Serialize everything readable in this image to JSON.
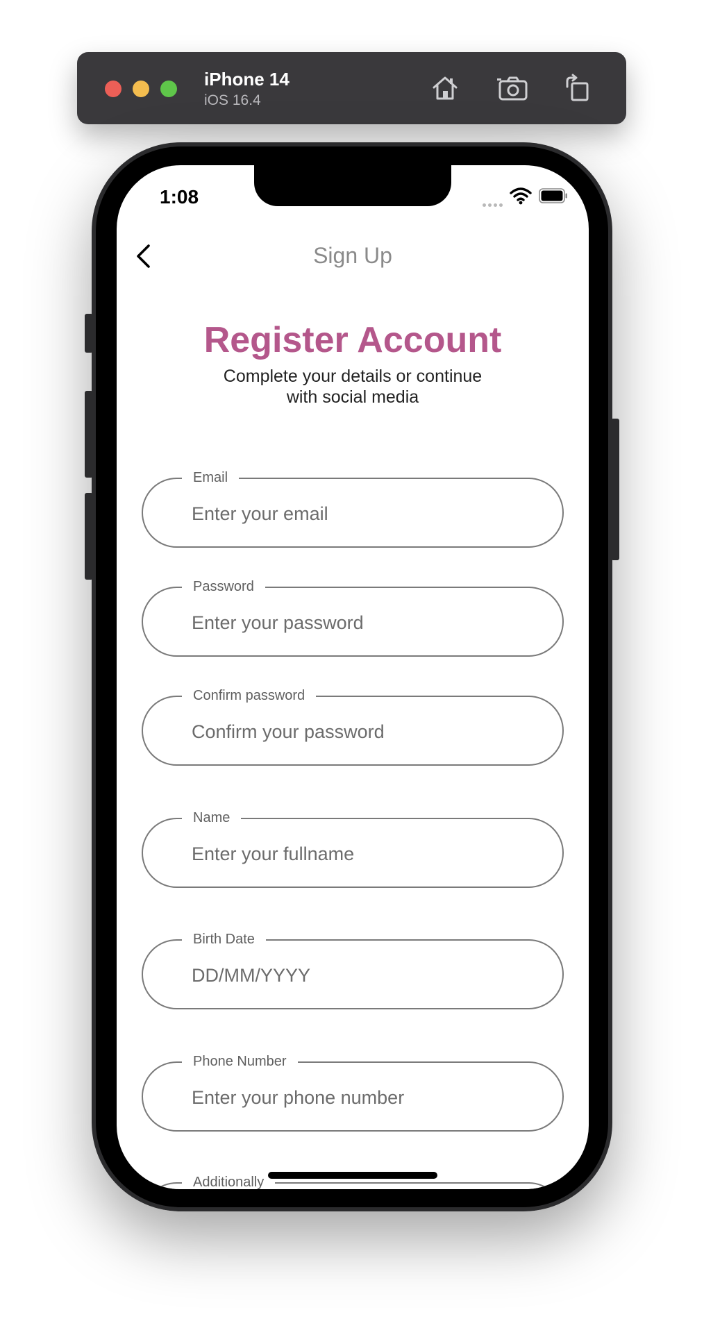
{
  "simulator": {
    "device_name": "iPhone 14",
    "os_version": "iOS 16.4",
    "buttons": [
      "home-icon",
      "screenshot-icon",
      "rotate-icon"
    ]
  },
  "status_bar": {
    "time": "1:08",
    "icons": [
      "wifi-icon",
      "battery-icon"
    ]
  },
  "nav": {
    "title": "Sign Up",
    "back_icon": "chevron-left-icon"
  },
  "header": {
    "title": "Register Account",
    "subtitle_line1": "Complete your details or continue",
    "subtitle_line2": "with social media"
  },
  "form": {
    "email": {
      "label": "Email",
      "placeholder": "Enter your email",
      "value": ""
    },
    "password": {
      "label": "Password",
      "placeholder": "Enter your password",
      "value": ""
    },
    "confirm_password": {
      "label": "Confirm password",
      "placeholder": "Confirm your password",
      "value": ""
    },
    "name": {
      "label": "Name",
      "placeholder": "Enter your fullname",
      "value": ""
    },
    "birth_date": {
      "label": "Birth Date",
      "placeholder": "DD/MM/YYYY",
      "value": ""
    },
    "phone": {
      "label": "Phone Number",
      "placeholder": "Enter your phone number",
      "value": ""
    },
    "additionally": {
      "label": "Additionally"
    }
  },
  "colors": {
    "accent": "#b4578b",
    "toolbar": "#3a393c",
    "field_border": "#7a7a7a"
  }
}
